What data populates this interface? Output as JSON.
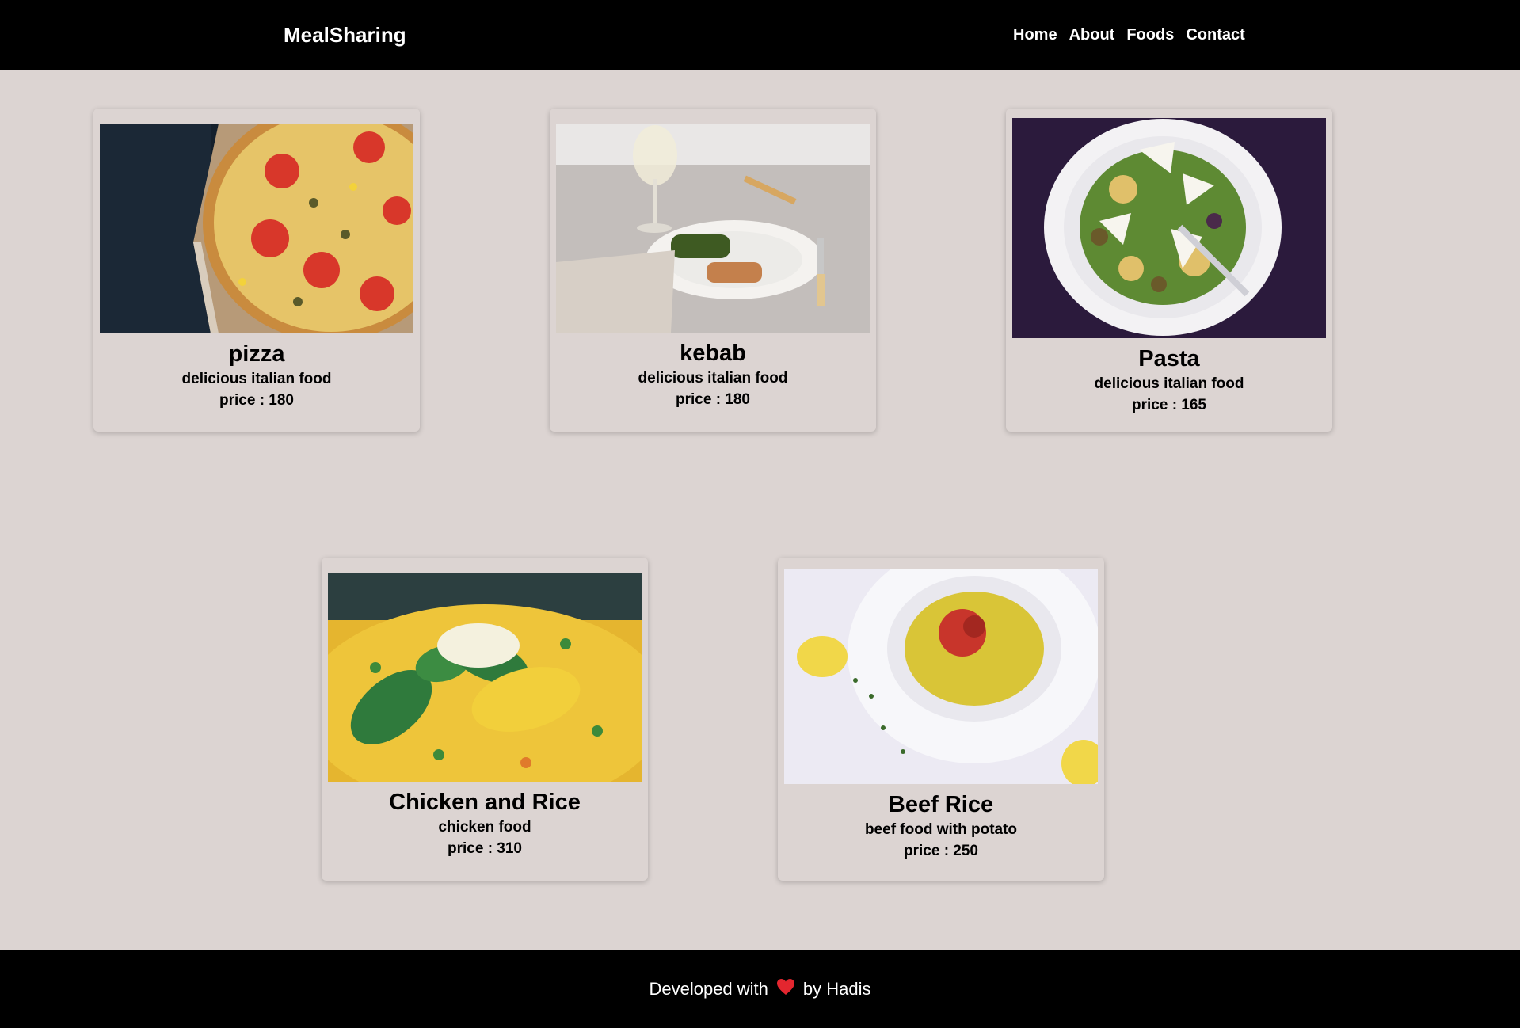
{
  "nav": {
    "brand": "MealSharing",
    "links": [
      "Home",
      "About",
      "Foods",
      "Contact"
    ]
  },
  "meals": [
    {
      "title": "pizza",
      "description": "delicious italian food",
      "price": "price : 180",
      "image": "pizza-photo"
    },
    {
      "title": "kebab",
      "description": "delicious italian food",
      "price": "price : 180",
      "image": "kebab-plate-photo"
    },
    {
      "title": "Pasta",
      "description": "delicious italian food",
      "price": "price : 165",
      "image": "pasta-salad-photo"
    },
    {
      "title": "Chicken and Rice",
      "description": "chicken food",
      "price": "price : 310",
      "image": "chicken-rice-photo"
    },
    {
      "title": "Beef Rice",
      "description": "beef food with potato",
      "price": "price : 250",
      "image": "beef-rice-photo"
    }
  ],
  "footer": {
    "prefix": "Developed with",
    "icon": "heart-icon",
    "suffix": "by Hadis"
  },
  "colors": {
    "background": "#dcd4d2",
    "navbar": "#000000",
    "footer": "#000000",
    "heart": "#e3262f"
  }
}
